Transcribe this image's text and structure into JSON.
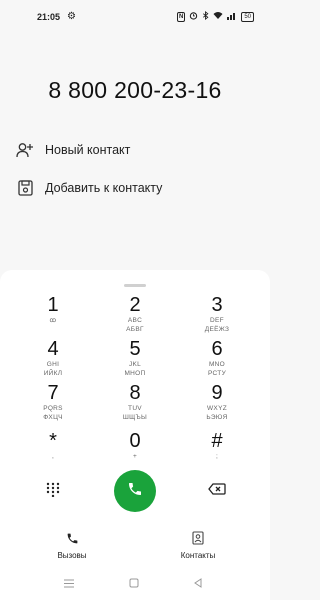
{
  "status_bar": {
    "time": "21:05",
    "nfc": "N",
    "battery": "50"
  },
  "dialed_number": "8 800 200-23-16",
  "actions": [
    {
      "label": "Новый контакт",
      "icon": "add-person-icon"
    },
    {
      "label": "Добавить к контакту",
      "icon": "save-contact-icon"
    }
  ],
  "keypad": [
    {
      "digit": "1",
      "line1": "ꝏ",
      "line2": ""
    },
    {
      "digit": "2",
      "line1": "ABC",
      "line2": "АБВГ"
    },
    {
      "digit": "3",
      "line1": "DEF",
      "line2": "ДЕЁЖЗ"
    },
    {
      "digit": "4",
      "line1": "GHI",
      "line2": "ИЙКЛ"
    },
    {
      "digit": "5",
      "line1": "JKL",
      "line2": "МНОП"
    },
    {
      "digit": "6",
      "line1": "MNO",
      "line2": "РСТУ"
    },
    {
      "digit": "7",
      "line1": "PQRS",
      "line2": "ФХЦЧ"
    },
    {
      "digit": "8",
      "line1": "TUV",
      "line2": "ШЩЪЫ"
    },
    {
      "digit": "9",
      "line1": "WXYZ",
      "line2": "ЬЭЮЯ"
    },
    {
      "digit": "*",
      "line1": ",",
      "line2": ""
    },
    {
      "digit": "0",
      "line1": "+",
      "line2": ""
    },
    {
      "digit": "#",
      "line1": ";",
      "line2": ""
    }
  ],
  "tabs": [
    {
      "label": "Вызовы",
      "icon": "phone-icon"
    },
    {
      "label": "Контакты",
      "icon": "contact-card-icon"
    }
  ],
  "colors": {
    "call_button": "#1aa33b"
  }
}
